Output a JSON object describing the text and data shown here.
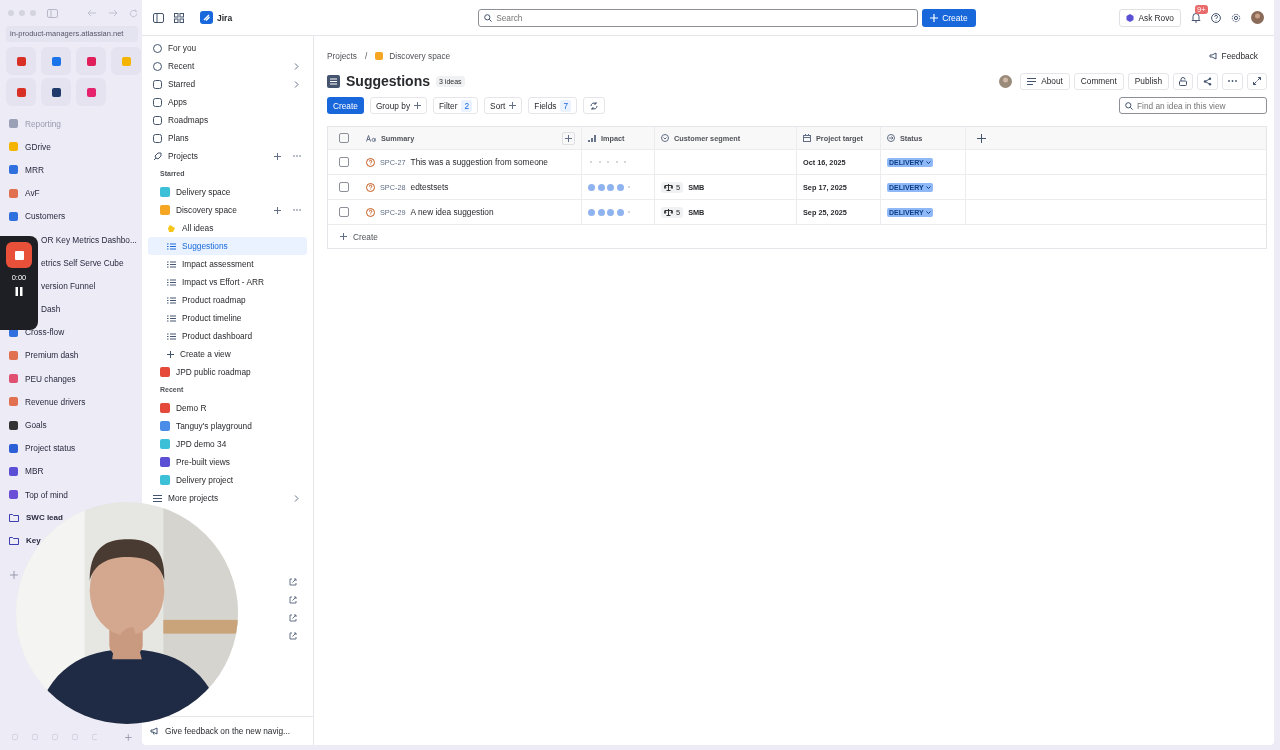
{
  "browser": {
    "url": "in-product-managers.atlassian.net",
    "items": [
      {
        "kind": "bookmark",
        "label": "Reporting",
        "disabled": true
      },
      {
        "kind": "bookmark",
        "label": "GDrive",
        "disabled": false
      },
      {
        "kind": "bookmark",
        "label": "MRR",
        "disabled": false
      },
      {
        "kind": "bookmark",
        "label": "AvF",
        "disabled": false
      },
      {
        "kind": "bookmark",
        "label": "Customers",
        "disabled": false
      },
      {
        "kind": "clipped",
        "label": "OR Key Metrics Dashbo...",
        "disabled": false
      },
      {
        "kind": "clipped",
        "label": "etrics Self Serve Cube",
        "disabled": false
      },
      {
        "kind": "clipped",
        "label": "version Funnel",
        "disabled": false
      },
      {
        "kind": "clipped",
        "label": "Dash",
        "disabled": false
      },
      {
        "kind": "bookmark",
        "label": "Cross-flow",
        "disabled": false
      },
      {
        "kind": "bookmark",
        "label": "Premium dash",
        "disabled": false
      },
      {
        "kind": "bookmark",
        "label": "PEU changes",
        "disabled": false
      },
      {
        "kind": "bookmark",
        "label": "Revenue drivers",
        "disabled": false
      },
      {
        "kind": "bookmark",
        "label": "Goals",
        "disabled": false
      },
      {
        "kind": "bookmark",
        "label": "Project status",
        "disabled": false
      },
      {
        "kind": "bookmark",
        "label": "MBR",
        "disabled": false
      },
      {
        "kind": "bookmark",
        "label": "Top of mind",
        "disabled": false
      },
      {
        "kind": "folder",
        "label": "SWC lead",
        "disabled": false
      },
      {
        "kind": "folder",
        "label": "Key",
        "disabled": false
      }
    ]
  },
  "recorder": {
    "time": "0:00"
  },
  "topbar": {
    "app": "Jira",
    "search": {
      "placeholder": "Search"
    },
    "create": "Create",
    "ask": "Ask Rovo",
    "badge": "9+"
  },
  "sidebar": {
    "nav": [
      {
        "label": "For you",
        "expandable": false,
        "selected": false
      },
      {
        "label": "Recent",
        "expandable": true,
        "selected": false
      },
      {
        "label": "Starred",
        "expandable": true,
        "selected": false
      },
      {
        "label": "Apps",
        "expandable": false,
        "selected": false
      },
      {
        "label": "Roadmaps",
        "expandable": false,
        "selected": false
      },
      {
        "label": "Plans",
        "expandable": false,
        "selected": false
      }
    ],
    "projects": "Projects",
    "starred_label": "Starred",
    "starred": [
      {
        "label": "Delivery space",
        "selected": false
      },
      {
        "label": "Discovery space",
        "selected": false,
        "children": [
          {
            "label": "All ideas",
            "selected": false
          },
          {
            "label": "Suggestions",
            "selected": true
          },
          {
            "label": "Impact assessment",
            "selected": false
          },
          {
            "label": "Impact vs Effort - ARR",
            "selected": false
          },
          {
            "label": "Product roadmap",
            "selected": false
          },
          {
            "label": "Product timeline",
            "selected": false
          },
          {
            "label": "Product dashboard",
            "selected": false
          }
        ]
      },
      {
        "label": "JPD public roadmap",
        "selected": false
      }
    ],
    "create_view": "Create a view",
    "recent_label": "Recent",
    "recent": [
      {
        "label": "Demo R",
        "selected": false
      },
      {
        "label": "Tanguy's playground",
        "selected": false
      },
      {
        "label": "JPD demo 34",
        "selected": false
      },
      {
        "label": "Pre-built views",
        "selected": false
      },
      {
        "label": "Delivery project",
        "selected": false
      }
    ],
    "more": "More projects",
    "feedback": "Give feedback on the new navig..."
  },
  "page": {
    "breadcrumbs": [
      "Projects",
      "Discovery space"
    ],
    "breadcrumb_separator": "/",
    "feedback": "Feedback",
    "title": "Suggestions",
    "count": "3 ideas",
    "actions": [
      "About",
      "Comment",
      "Publish"
    ],
    "toolbar": {
      "create": "Create",
      "group_by": "Group by",
      "filter": "Filter",
      "filter_count": "2",
      "sort": "Sort",
      "fields": "Fields",
      "fields_count": "7",
      "search": {
        "placeholder": "Find an idea in this view"
      }
    }
  },
  "table": {
    "all_checked": false,
    "columns": [
      "Summary",
      "Impact",
      "Customer segment",
      "Project target",
      "Status"
    ],
    "rows": [
      {
        "checked": false,
        "key": "SPC-27",
        "summary": "This was a suggestion from someone",
        "stars": 0,
        "date": "Oct 16, 2025",
        "status": "DELIVERY"
      },
      {
        "checked": false,
        "key": "SPC-28",
        "summary": "edtestsets",
        "stars": 4,
        "weight": "5",
        "segment": "SMB",
        "date": "Sep 17, 2025",
        "status": "DELIVERY"
      },
      {
        "checked": false,
        "key": "SPC-29",
        "summary": "A new idea suggestion",
        "stars": 4,
        "weight": "5",
        "segment": "SMB",
        "date": "Sep 25, 2025",
        "status": "DELIVERY"
      }
    ],
    "create": "Create"
  }
}
